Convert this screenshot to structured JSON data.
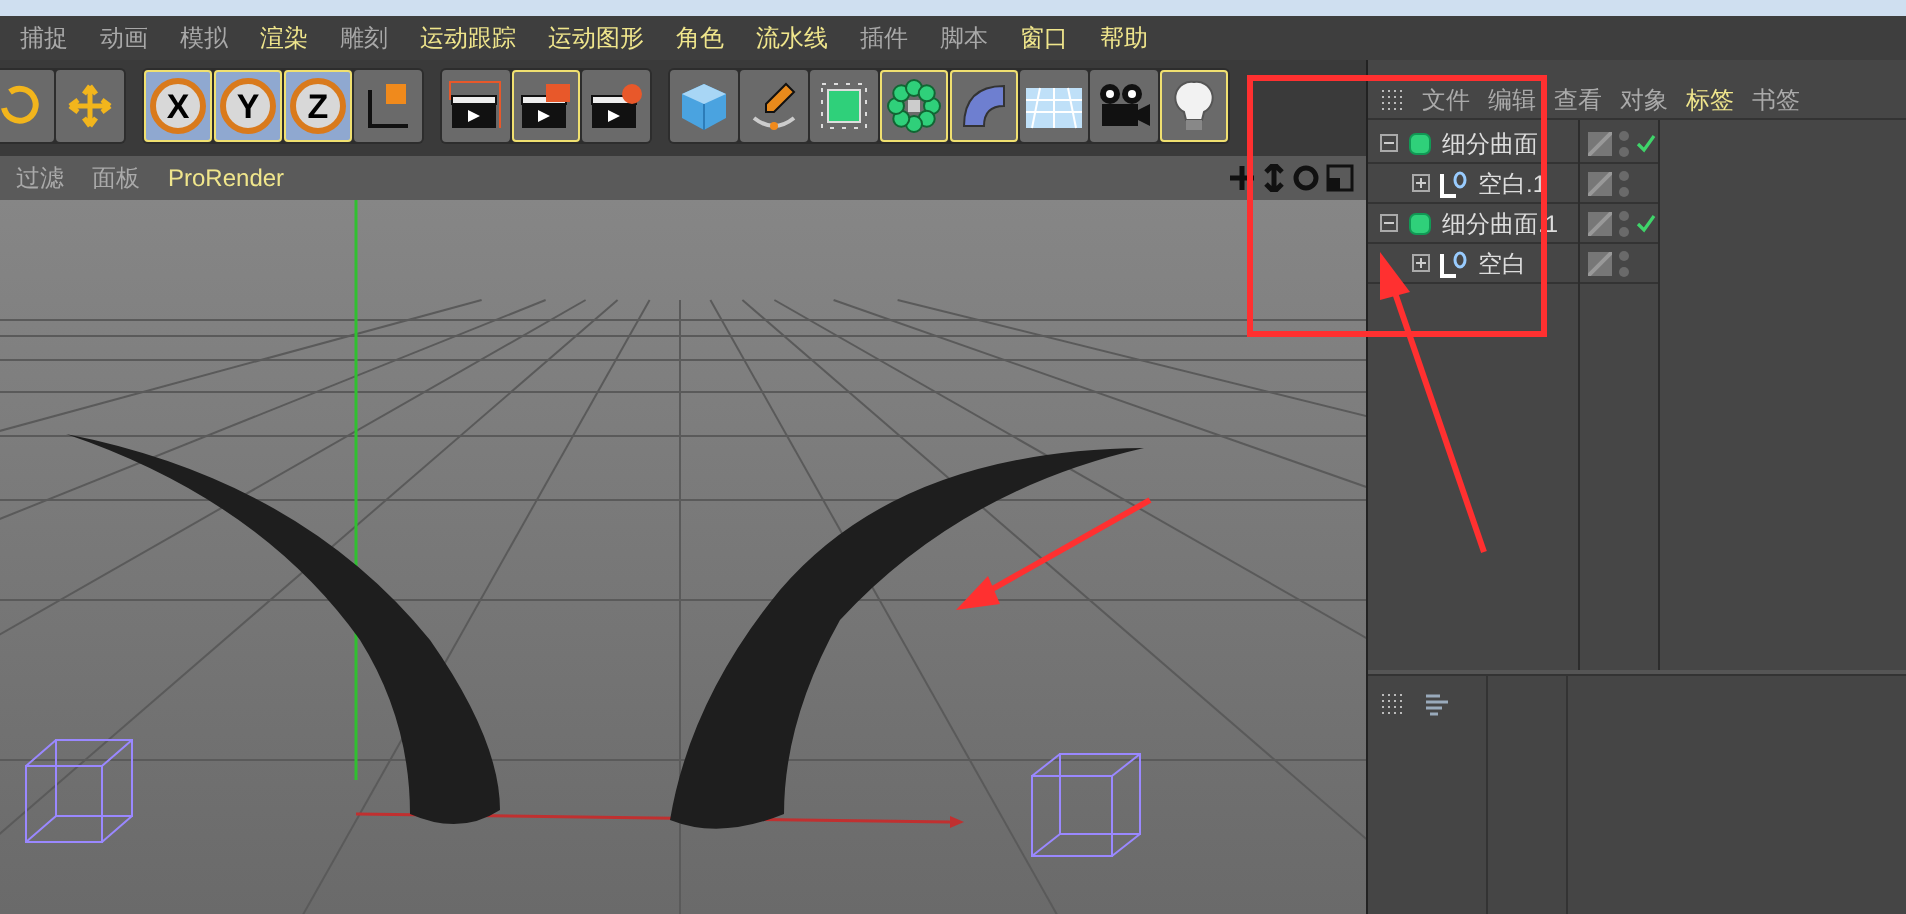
{
  "menu_bar": [
    {
      "label": "捕捉",
      "highlighted": false
    },
    {
      "label": "动画",
      "highlighted": false
    },
    {
      "label": "模拟",
      "highlighted": false
    },
    {
      "label": "渲染",
      "highlighted": true
    },
    {
      "label": "雕刻",
      "highlighted": false
    },
    {
      "label": "运动跟踪",
      "highlighted": true
    },
    {
      "label": "运动图形",
      "highlighted": true
    },
    {
      "label": "角色",
      "highlighted": true
    },
    {
      "label": "流水线",
      "highlighted": true
    },
    {
      "label": "插件",
      "highlighted": false
    },
    {
      "label": "脚本",
      "highlighted": false
    },
    {
      "label": "窗口",
      "highlighted": true
    },
    {
      "label": "帮助",
      "highlighted": true
    }
  ],
  "toolbar": [
    {
      "kind": "rotate",
      "selected": false
    },
    {
      "kind": "move",
      "selected": false
    },
    {
      "kind": "x",
      "label": "X",
      "selected": true
    },
    {
      "kind": "y",
      "label": "Y",
      "selected": true
    },
    {
      "kind": "z",
      "label": "Z",
      "selected": true
    },
    {
      "kind": "coords",
      "selected": false
    },
    {
      "kind": "render-view",
      "selected": false
    },
    {
      "kind": "render-region",
      "selected": true
    },
    {
      "kind": "render-settings",
      "selected": false
    },
    {
      "kind": "cube",
      "selected": false
    },
    {
      "kind": "pen",
      "selected": false
    },
    {
      "kind": "subdivision",
      "selected": false
    },
    {
      "kind": "cloner",
      "selected": true
    },
    {
      "kind": "bend",
      "selected": true
    },
    {
      "kind": "floor",
      "selected": false
    },
    {
      "kind": "camera",
      "selected": false
    },
    {
      "kind": "light",
      "selected": true
    }
  ],
  "viewport": {
    "menu": [
      {
        "label": "过滤",
        "highlighted": false
      },
      {
        "label": "面板",
        "highlighted": false
      },
      {
        "label": "ProRender",
        "highlighted": true
      }
    ]
  },
  "object_manager": {
    "menu": [
      {
        "label": "文件",
        "highlighted": false
      },
      {
        "label": "编辑",
        "highlighted": false
      },
      {
        "label": "查看",
        "highlighted": false
      },
      {
        "label": "对象",
        "highlighted": false
      },
      {
        "label": "标签",
        "highlighted": true
      },
      {
        "label": "书签",
        "highlighted": false
      }
    ],
    "objects": [
      {
        "name": "细分曲面",
        "kind": "subdivision",
        "expanded": true,
        "checked": true,
        "children": [
          {
            "name": "空白.1",
            "kind": "null",
            "expanded": false,
            "checked": false
          }
        ]
      },
      {
        "name": "细分曲面.1",
        "kind": "subdivision",
        "expanded": true,
        "checked": true,
        "children": [
          {
            "name": "空白",
            "kind": "null",
            "expanded": false,
            "checked": false
          }
        ]
      }
    ]
  }
}
